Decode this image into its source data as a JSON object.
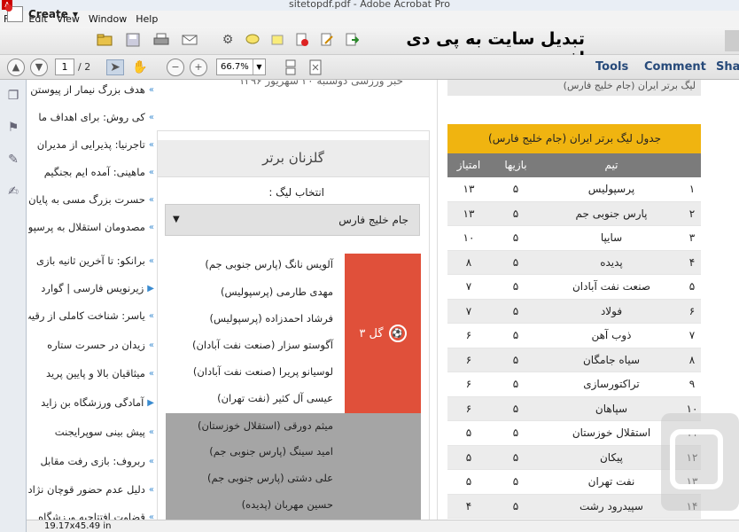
{
  "window": {
    "title": "sitetopdf.pdf - Adobe Acrobat Pro"
  },
  "menu": [
    "File",
    "Edit",
    "View",
    "Window",
    "Help"
  ],
  "toolbar": {
    "create_label": "Create",
    "doc_title": "تبدیل سایت به پی دی اف",
    "tools_label": "Tools",
    "comment_label": "Comment",
    "share_label": "Shar"
  },
  "nav": {
    "page_current": "1",
    "page_total": "/ 2",
    "zoom": "66.7%"
  },
  "news": [
    "هدف بزرگ نیمار از پیوستن",
    "کی روش: برای اهداف ما",
    "تاجرنیا: پذیرایی از مدیران",
    "ماهینی: آمده ایم بجنگیم",
    "حسرت بزرگ مسی به پایان",
    "مصدومان استقلال به پرسپولیس",
    "برانکو: تا آخرین ثانیه بازی",
    "زیرنویس فارسی | گوارد",
    "یاسر: شناخت کاملی از رقیب",
    "زیدان در حسرت ستاره",
    "میثاقیان بالا و پایین پرید",
    "آمادگی ورزشگاه بن زاید",
    "پیش بینی سوپرایجنت",
    "ربروف: بازی رفت مقابل",
    "دلیل عدم حضور قوچان نژاد",
    "قضاوت افتتاحیه ورزشگاه"
  ],
  "mid": {
    "top_text": "خبر ورزشی دوشنبه ۲۰ شهریور ۱۳۹۶",
    "scorers_title": "گلزنان برتر",
    "league_label": "انتخاب لیگ :",
    "league_select": "جام خلیج فارس",
    "goals_badge": "۳ گل",
    "scorers_red": [
      "آلویس نانگ (پارس جنوبی جم)",
      "مهدی طارمی (پرسپولیس)",
      "فرشاد احمدزاده (پرسپولیس)",
      "آگوستو سزار (صنعت نفت آبادان)",
      "لوسیانو پریرا (صنعت نفت آبادان)",
      "عیسی آل کثیر (نفت تهران)"
    ],
    "scorers_gray": [
      "میثم دورقی (استقلال خوزستان)",
      "امید سینگ (پارس جنوبی جم)",
      "علی دشتی (پارس جنوبی جم)",
      "حسین مهربان (پدیده)"
    ]
  },
  "table": {
    "top_text": "لیگ برتر ایران (جام خلیج فارس)",
    "title": "جدول لیگ برتر ایران (جام خلیج فارس)",
    "col_team": "تیم",
    "col_games": "بازیها",
    "col_points": "امتیاز",
    "rows": [
      {
        "rank": "۱",
        "team": "پرسپولیس",
        "games": "۵",
        "points": "۱۳"
      },
      {
        "rank": "۲",
        "team": "پارس جنوبی جم",
        "games": "۵",
        "points": "۱۳"
      },
      {
        "rank": "۳",
        "team": "سایپا",
        "games": "۵",
        "points": "۱۰"
      },
      {
        "rank": "۴",
        "team": "پدیده",
        "games": "۵",
        "points": "۸"
      },
      {
        "rank": "۵",
        "team": "صنعت نفت آبادان",
        "games": "۵",
        "points": "۷"
      },
      {
        "rank": "۶",
        "team": "فولاد",
        "games": "۵",
        "points": "۷"
      },
      {
        "rank": "۷",
        "team": "ذوب آهن",
        "games": "۵",
        "points": "۶"
      },
      {
        "rank": "۸",
        "team": "سیاه جامگان",
        "games": "۵",
        "points": "۶"
      },
      {
        "rank": "۹",
        "team": "تراکتورسازی",
        "games": "۵",
        "points": "۶"
      },
      {
        "rank": "۱۰",
        "team": "سپاهان",
        "games": "۵",
        "points": "۶"
      },
      {
        "rank": "۱۱",
        "team": "استقلال خوزستان",
        "games": "۵",
        "points": "۵"
      },
      {
        "rank": "۱۲",
        "team": "پیکان",
        "games": "۵",
        "points": "۵"
      },
      {
        "rank": "۱۳",
        "team": "نفت تهران",
        "games": "۵",
        "points": "۵"
      },
      {
        "rank": "۱۴",
        "team": "سپیدرود رشت",
        "games": "۵",
        "points": "۴"
      }
    ]
  },
  "status": {
    "dimensions": "19.17x45.49 in"
  }
}
